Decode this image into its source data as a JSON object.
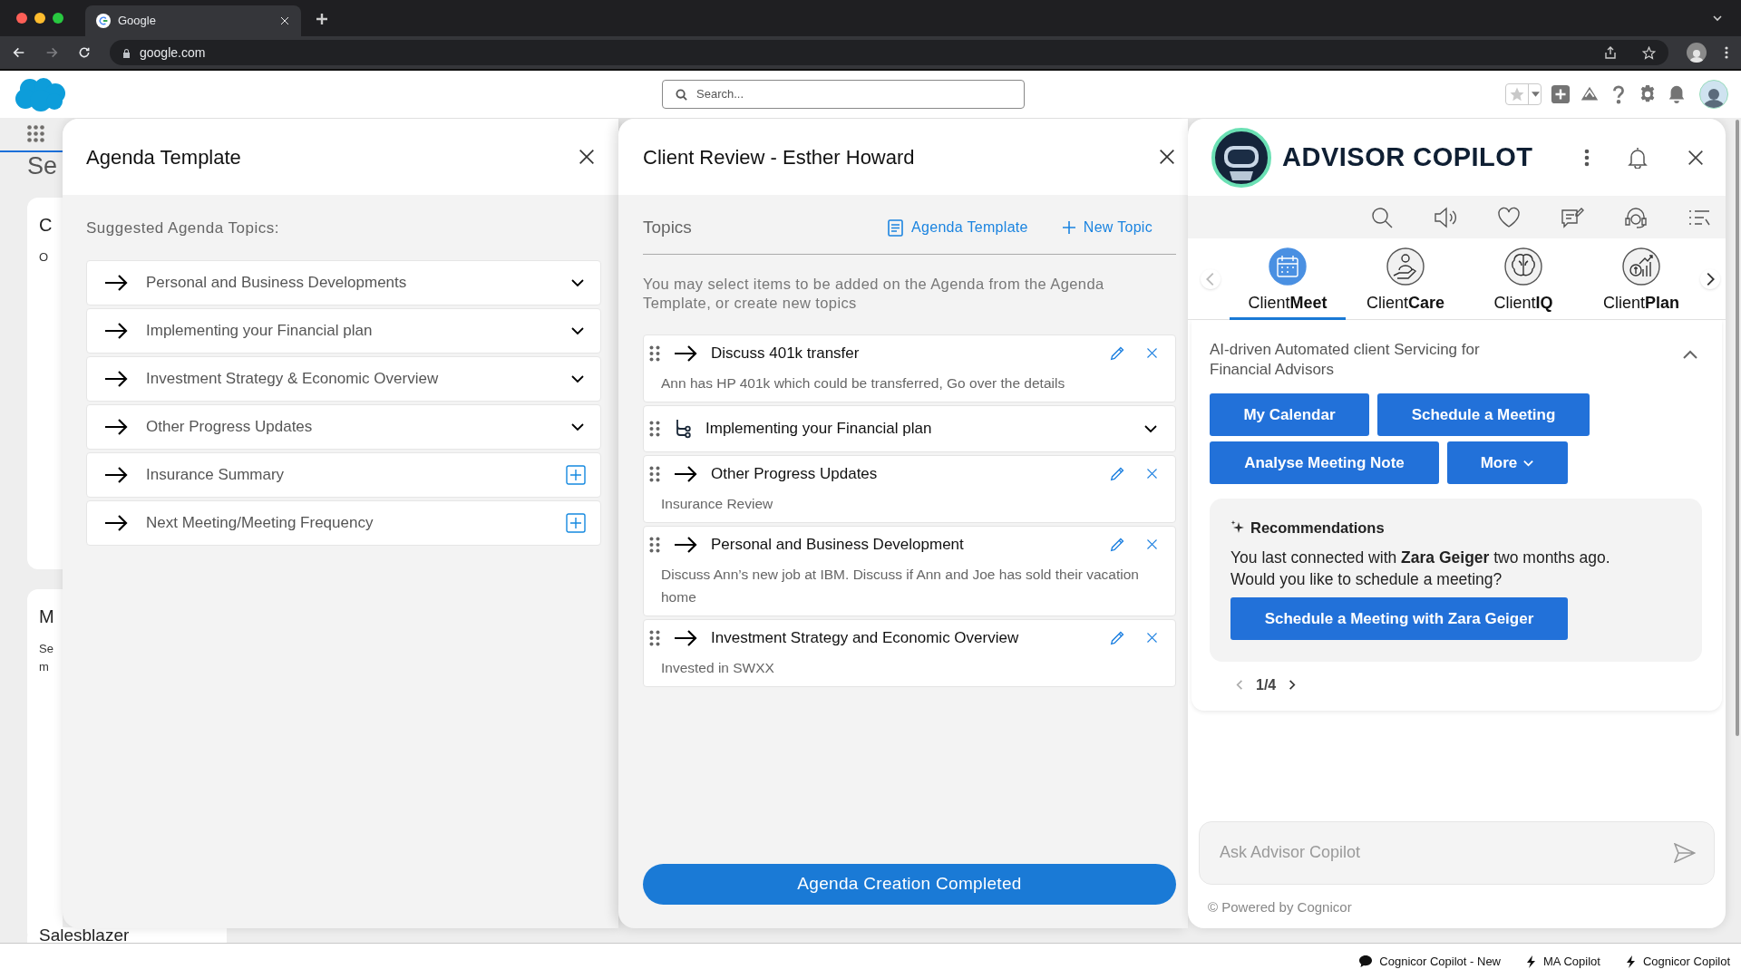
{
  "browser": {
    "tab_title": "Google",
    "url": "google.com",
    "nav": [
      {
        "kind": "back",
        "disabled": false
      },
      {
        "kind": "forward",
        "disabled": true
      },
      {
        "kind": "reload",
        "disabled": false
      }
    ]
  },
  "header": {
    "search_placeholder": "Search..."
  },
  "background_page": {
    "heading": "Se",
    "cards": [
      {
        "title": "C",
        "lines": [
          "O"
        ]
      },
      {
        "title": "M",
        "lines": [
          "Se",
          "m"
        ]
      },
      {
        "title": "Salesblazer"
      }
    ]
  },
  "agenda_template": {
    "title": "Agenda Template",
    "section_label": "Suggested Agenda Topics:",
    "topics": [
      {
        "label": "Personal and Business Developments",
        "kind": "expand"
      },
      {
        "label": "Implementing your Financial plan",
        "kind": "expand"
      },
      {
        "label": "Investment Strategy & Economic Overview",
        "kind": "expand"
      },
      {
        "label": "Other Progress Updates",
        "kind": "expand"
      },
      {
        "label": "Insurance Summary",
        "kind": "add"
      },
      {
        "label": "Next Meeting/Meeting Frequency",
        "kind": "add"
      }
    ]
  },
  "client_review": {
    "title": "Client Review - Esther Howard",
    "topics_heading": "Topics",
    "links": [
      {
        "kind": "template",
        "label": "Agenda Template"
      },
      {
        "kind": "new",
        "label": "New Topic"
      }
    ],
    "description": "You may select items to be added on the Agenda from the Agenda Template, or create new topics",
    "topics": [
      {
        "kind": "item",
        "title": "Discuss 401k transfer",
        "note": "Ann has HP 401k which could be transferred, Go over the details"
      },
      {
        "kind": "group",
        "title": "Implementing your Financial plan"
      },
      {
        "kind": "item",
        "title": "Other Progress Updates",
        "note": "Insurance Review"
      },
      {
        "kind": "item",
        "title": "Personal and Business Development",
        "note": "Discuss Ann’s new job at IBM. Discuss if Ann and Joe has sold their vacation home"
      },
      {
        "kind": "item",
        "title": "Investment Strategy and Economic Overview",
        "note": "Invested in SWXX"
      }
    ],
    "complete_button": "Agenda Creation Completed"
  },
  "copilot": {
    "title": "ADVISOR COPILOT",
    "product_nav": [
      {
        "kind": "prev",
        "disabled": true
      },
      {
        "kind": "next",
        "disabled": false
      }
    ],
    "products": [
      {
        "label": "Client**Meet**",
        "selected": true
      },
      {
        "label": "Client**Care**",
        "selected": false
      },
      {
        "label": "Client**IQ**",
        "selected": false
      },
      {
        "label": "Client**Plan**",
        "selected": false
      }
    ],
    "intro": {
      "text": "AI-driven Automated client Servicing for Financial Advisors",
      "expanded": true
    },
    "actions": [
      {
        "label": "My Calendar",
        "kind": "button"
      },
      {
        "label": "Schedule a Meeting",
        "kind": "button"
      },
      {
        "label": "Analyse Meeting Note",
        "kind": "button"
      },
      {
        "label": "More",
        "kind": "dropdown"
      }
    ],
    "recommendations": {
      "heading": "Recommendations",
      "text": "You last connected with **Zara Geiger** two months ago. Would you like to schedule a meeting?",
      "button": "Schedule a Meeting with Zara Geiger"
    },
    "pager": {
      "label": "1/4",
      "buttons": [
        {
          "kind": "prev",
          "disabled": true
        },
        {
          "kind": "next",
          "disabled": false
        }
      ]
    },
    "ask_placeholder": "Ask Advisor Copilot",
    "footer": "© Powered by Cognicor"
  },
  "utility_bar": [
    {
      "kind": "chat",
      "label": "Cognicor Copilot - New"
    },
    {
      "kind": "bolt",
      "label": "MA Copilot"
    },
    {
      "kind": "bolt",
      "label": "Cognicor Copilot"
    }
  ]
}
